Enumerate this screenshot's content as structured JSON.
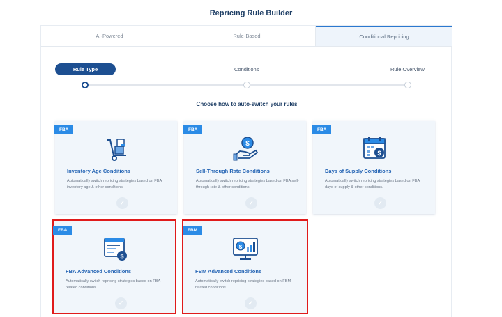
{
  "header": {
    "title": "Repricing Rule Builder"
  },
  "tabs": [
    {
      "label": "AI-Powered",
      "active": false
    },
    {
      "label": "Rule-Based",
      "active": false
    },
    {
      "label": "Conditional Repricing",
      "active": true
    }
  ],
  "stepper": {
    "steps": [
      {
        "label": "Rule Type",
        "active": true
      },
      {
        "label": "Conditions",
        "active": false
      },
      {
        "label": "Rule Overview",
        "active": false
      }
    ]
  },
  "section": {
    "title": "Choose how to auto-switch your rules"
  },
  "cards": [
    {
      "badge": "FBA",
      "title": "Inventory Age Conditions",
      "description": "Automatically switch repricing strategies based on FBA inventory age & other conditions.",
      "icon": "hand-truck-boxes-icon",
      "highlighted": false
    },
    {
      "badge": "FBA",
      "title": "Sell-Through Rate Conditions",
      "description": "Automatically switch repricing strategies based on FBA sell-through rate & other conditions.",
      "icon": "hand-coin-icon",
      "highlighted": false
    },
    {
      "badge": "FBA",
      "title": "Days of Supply Conditions",
      "description": "Automatically switch repricing strategies based on FBA days of supply & other conditions.",
      "icon": "calendar-coin-icon",
      "highlighted": false
    },
    {
      "badge": "FBA",
      "title": "FBA Advanced Conditions",
      "description": "Automatically switch repricing strategies based on FBA related conditions.",
      "icon": "window-coin-icon",
      "highlighted": true
    },
    {
      "badge": "FBM",
      "title": "FBM Advanced Conditions",
      "description": "Automatically switch repricing strategies based on FBM related conditions.",
      "icon": "monitor-chart-icon",
      "highlighted": true
    }
  ],
  "colors": {
    "accent": "#1d4f91",
    "badge": "#2b8be6",
    "title": "#2464b4",
    "highlight": "#e01b1b"
  }
}
